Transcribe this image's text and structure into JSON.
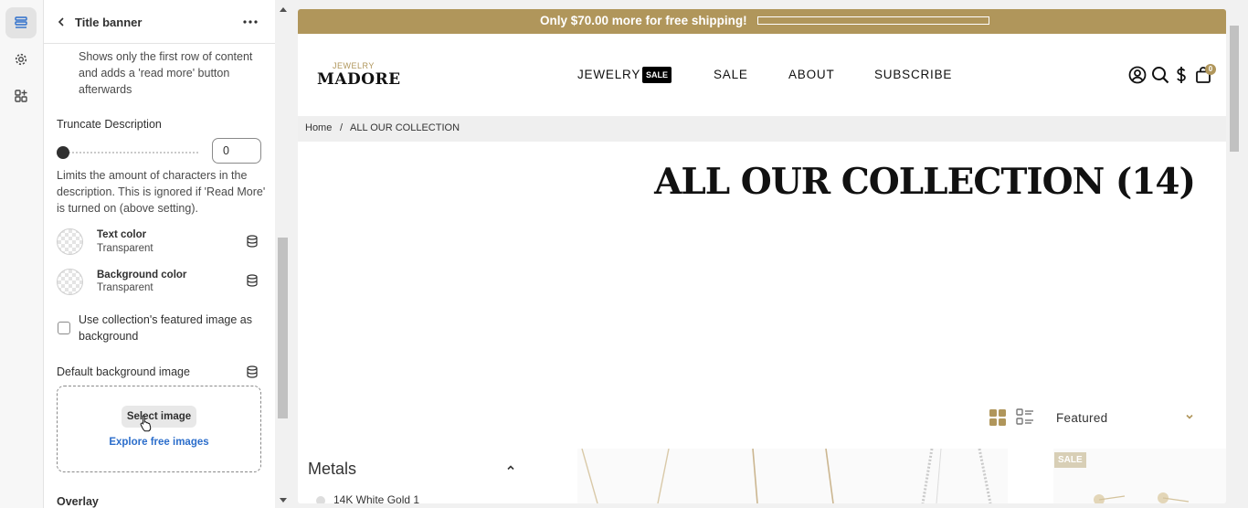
{
  "editor": {
    "rail": {
      "icons": [
        "sections-icon",
        "gear-icon",
        "apps-icon"
      ]
    },
    "panel": {
      "title": "Title banner",
      "read_more_help": "Shows only the first row of content and adds a 'read more' button afterwards",
      "truncate": {
        "label": "Truncate Description",
        "value": "0",
        "help": "Limits the amount of characters in the description. This is ignored if 'Read More' is turned on (above setting)."
      },
      "text_color": {
        "label": "Text color",
        "value": "Transparent"
      },
      "background_color": {
        "label": "Background color",
        "value": "Transparent"
      },
      "featured_image_checkbox": {
        "label": "Use collection's featured image as background",
        "checked": false
      },
      "default_bg": {
        "label": "Default background image",
        "select_label": "Select image",
        "explore_label": "Explore free images"
      },
      "overlay_heading": "Overlay"
    }
  },
  "preview": {
    "announcement": {
      "text": "Only $70.00 more for free shipping!",
      "progress": 0
    },
    "logo": {
      "top": "JEWELRY",
      "name": "MADORE"
    },
    "nav": [
      {
        "label": "JEWELRY",
        "badge": "SALE"
      },
      {
        "label": "SALE"
      },
      {
        "label": "ABOUT"
      },
      {
        "label": "SUBSCRIBE"
      }
    ],
    "header_icons": [
      "account-icon",
      "search-icon",
      "currency-icon",
      "cart-icon"
    ],
    "cart_count": "0",
    "breadcrumb": {
      "home": "Home",
      "sep": "/",
      "current": "ALL OUR COLLECTION"
    },
    "collection_title": "ALL OUR COLLECTION (14)",
    "sort": {
      "value": "Featured"
    },
    "filter": {
      "heading": "Metals",
      "options": [
        "14K White Gold 1"
      ]
    },
    "product_badge": "SALE"
  },
  "colors": {
    "accent_gold": "#b0965b",
    "link_blue": "#2c6ecb"
  }
}
